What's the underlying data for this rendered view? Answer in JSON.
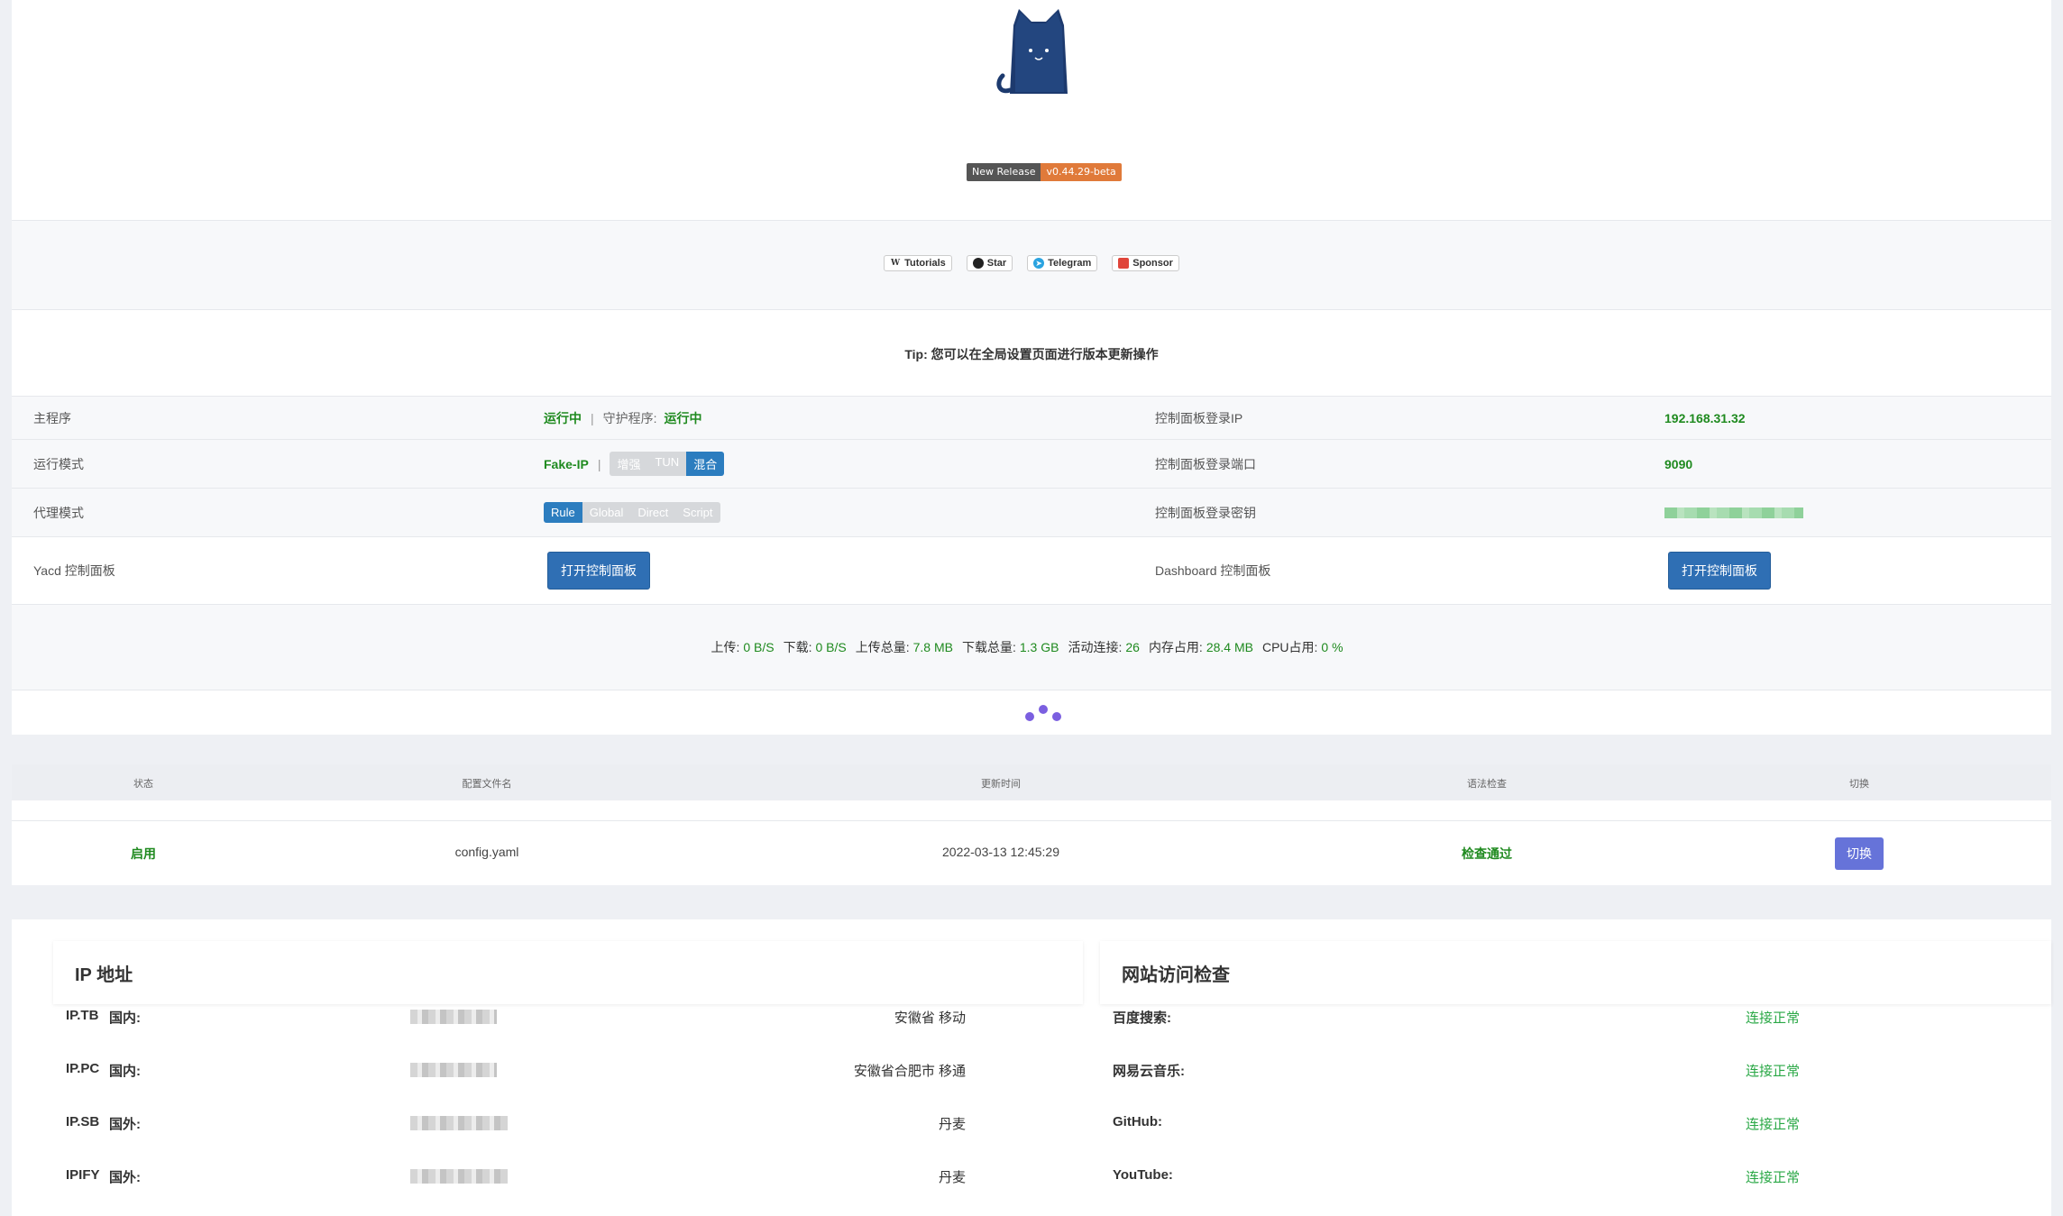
{
  "header": {
    "release_label": "New Release",
    "release_version": "v0.44.29-beta",
    "links": [
      {
        "icon": "wikipedia-icon",
        "label": "Tutorials"
      },
      {
        "icon": "github-icon",
        "label": "Star"
      },
      {
        "icon": "telegram-icon",
        "label": "Telegram"
      },
      {
        "icon": "sponsor-icon",
        "label": "Sponsor"
      }
    ],
    "tip": "Tip: 您可以在全局设置页面进行版本更新操作"
  },
  "status": {
    "main_program_label": "主程序",
    "main_program_value": "运行中",
    "daemon_label": "守护程序:",
    "daemon_value": "运行中",
    "panel_ip_label": "控制面板登录IP",
    "panel_ip_value": "192.168.31.32",
    "run_mode_label": "运行模式",
    "run_mode_value": "Fake-IP",
    "run_mode_options": [
      "增强",
      "TUN",
      "混合"
    ],
    "run_mode_active": "混合",
    "panel_port_label": "控制面板登录端口",
    "panel_port_value": "9090",
    "proxy_mode_label": "代理模式",
    "proxy_mode_options": [
      "Rule",
      "Global",
      "Direct",
      "Script"
    ],
    "proxy_mode_active": "Rule",
    "panel_secret_label": "控制面板登录密钥",
    "yacd_label": "Yacd 控制面板",
    "yacd_button": "打开控制面板",
    "dashboard_label": "Dashboard 控制面板",
    "dashboard_button": "打开控制面板"
  },
  "traffic": {
    "upload_label": "上传:",
    "upload_value": "0 B/S",
    "download_label": "下载:",
    "download_value": "0 B/S",
    "upload_total_label": "上传总量:",
    "upload_total_value": "7.8 MB",
    "download_total_label": "下载总量:",
    "download_total_value": "1.3 GB",
    "connections_label": "活动连接:",
    "connections_value": "26",
    "memory_label": "内存占用:",
    "memory_value": "28.4 MB",
    "cpu_label": "CPU占用:",
    "cpu_value": "0 %"
  },
  "config_table": {
    "headers": [
      "状态",
      "配置文件名",
      "更新时间",
      "语法检查",
      "切换"
    ],
    "row": {
      "status": "启用",
      "filename": "config.yaml",
      "updated": "2022-03-13 12:45:29",
      "syntax": "检查通过",
      "switch_button": "切换"
    }
  },
  "ip_panel": {
    "title": "IP 地址",
    "rows": [
      {
        "source": "IP.TB",
        "region": "国内:",
        "location": "安徽省 移动"
      },
      {
        "source": "IP.PC",
        "region": "国内:",
        "location": "安徽省合肥市 移通"
      },
      {
        "source": "IP.SB",
        "region": "国外:",
        "location": "丹麦"
      },
      {
        "source": "IPIFY",
        "region": "国外:",
        "location": "丹麦"
      }
    ]
  },
  "site_panel": {
    "title": "网站访问检查",
    "rows": [
      {
        "site": "百度搜索:",
        "result": "连接正常"
      },
      {
        "site": "网易云音乐:",
        "result": "连接正常"
      },
      {
        "site": "GitHub:",
        "result": "连接正常"
      },
      {
        "site": "YouTube:",
        "result": "连接正常"
      }
    ]
  },
  "colors": {
    "accent_blue": "#2f6fb4",
    "status_green": "#1f8a1f",
    "switch_purple": "#6673d9",
    "release_orange": "#e07a3a"
  }
}
